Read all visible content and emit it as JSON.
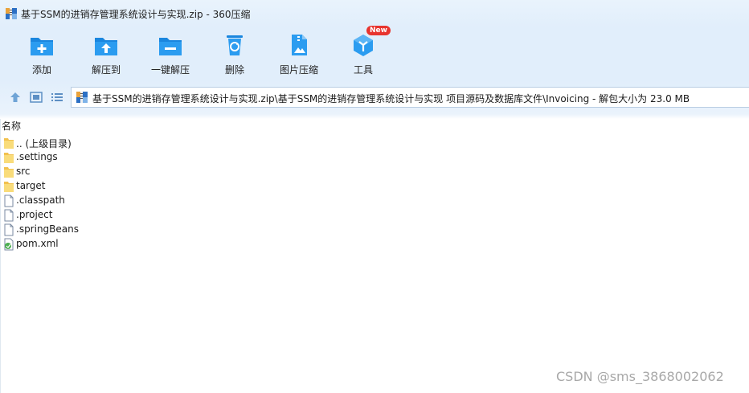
{
  "window": {
    "title": "基于SSM的进销存管理系统设计与实现.zip - 360压缩"
  },
  "toolbar": {
    "items": [
      {
        "label": "添加",
        "icon": "folder-add-icon"
      },
      {
        "label": "解压到",
        "icon": "folder-extract-icon"
      },
      {
        "label": "一键解压",
        "icon": "folder-oneclick-extract-icon"
      },
      {
        "label": "删除",
        "icon": "recycle-bin-icon"
      },
      {
        "label": "图片压缩",
        "icon": "image-compress-icon"
      },
      {
        "label": "工具",
        "icon": "tools-cube-icon"
      }
    ],
    "badge": "New"
  },
  "address": {
    "path": "基于SSM的进销存管理系统设计与实现.zip\\基于SSM的进销存管理系统设计与实现 项目源码及数据库文件\\Invoicing - 解包大小为 23.0 MB"
  },
  "list": {
    "header": "名称",
    "rows": [
      {
        "name": ".. (上级目录)",
        "type": "folder"
      },
      {
        "name": ".settings",
        "type": "folder"
      },
      {
        "name": "src",
        "type": "folder"
      },
      {
        "name": "target",
        "type": "folder"
      },
      {
        "name": ".classpath",
        "type": "file"
      },
      {
        "name": ".project",
        "type": "file"
      },
      {
        "name": ".springBeans",
        "type": "file"
      },
      {
        "name": "pom.xml",
        "type": "xml"
      }
    ]
  },
  "watermark": "CSDN @sms_3868002062",
  "colors": {
    "accent": "#1e90e6",
    "toolbar_bg": "#e1eefb",
    "folder": "#f7d56b",
    "badge": "#e8342e"
  }
}
